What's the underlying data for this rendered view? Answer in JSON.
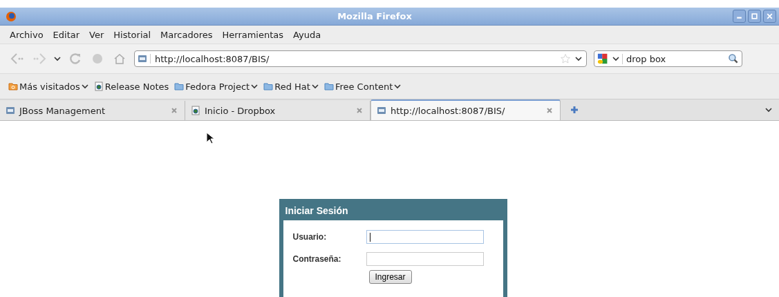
{
  "window": {
    "title": "Mozilla Firefox"
  },
  "menu": [
    "Archivo",
    "Editar",
    "Ver",
    "Historial",
    "Marcadores",
    "Herramientas",
    "Ayuda"
  ],
  "address": {
    "value": "http://localhost:8087/BIS/"
  },
  "search": {
    "value": "drop box"
  },
  "bookmarks": [
    {
      "label": "Más visitados",
      "kind": "smart",
      "dropdown": true
    },
    {
      "label": "Release Notes",
      "kind": "page",
      "dropdown": false
    },
    {
      "label": "Fedora Project",
      "kind": "folder",
      "dropdown": true
    },
    {
      "label": "Red Hat",
      "kind": "folder",
      "dropdown": true
    },
    {
      "label": "Free Content",
      "kind": "folder",
      "dropdown": true
    }
  ],
  "tabs": [
    {
      "label": "JBoss Management",
      "kind": "jboss",
      "selected": false
    },
    {
      "label": "Inicio - Dropbox",
      "kind": "page",
      "selected": false
    },
    {
      "label": "http://localhost:8087/BIS/",
      "kind": "jboss",
      "selected": true
    }
  ],
  "login": {
    "title": "Iniciar Sesión",
    "fields": [
      {
        "label": "Usuario:",
        "focused": true
      },
      {
        "label": "Contraseña:",
        "focused": false
      }
    ],
    "button": "Ingresar"
  }
}
